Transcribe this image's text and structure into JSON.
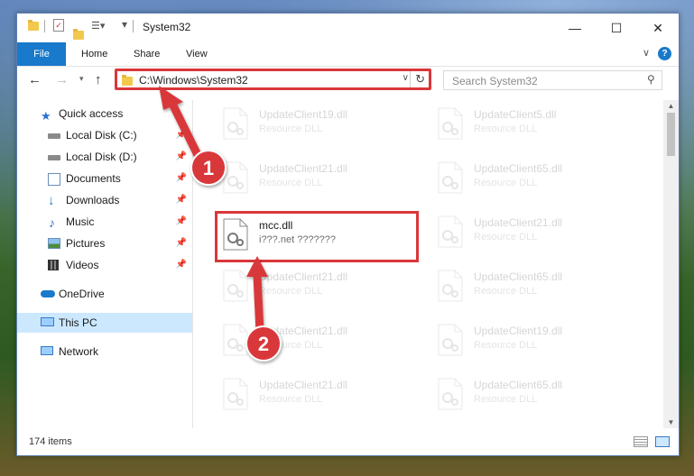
{
  "window": {
    "title": "System32",
    "controls": {
      "minimize": "—",
      "maximize": "☐",
      "close": "✕"
    }
  },
  "ribbon": {
    "tabs": [
      "File",
      "Home",
      "Share",
      "View"
    ],
    "help": "?"
  },
  "nav": {
    "address": "C:\\Windows\\System32",
    "search_placeholder": "Search System32"
  },
  "sidebar": {
    "items": [
      {
        "label": "Quick access",
        "icon": "star-icon",
        "pinned": false
      },
      {
        "label": "Local Disk (C:)",
        "icon": "drive-icon",
        "pinned": true
      },
      {
        "label": "Local Disk (D:)",
        "icon": "drive-icon",
        "pinned": true
      },
      {
        "label": "Documents",
        "icon": "documents-icon",
        "pinned": true
      },
      {
        "label": "Downloads",
        "icon": "download-icon",
        "pinned": true
      },
      {
        "label": "Music",
        "icon": "music-icon",
        "pinned": true
      },
      {
        "label": "Pictures",
        "icon": "pictures-icon",
        "pinned": true
      },
      {
        "label": "Videos",
        "icon": "videos-icon",
        "pinned": true
      },
      {
        "label": "OneDrive",
        "icon": "cloud-icon",
        "pinned": false
      },
      {
        "label": "This PC",
        "icon": "pc-icon",
        "pinned": false,
        "selected": true
      },
      {
        "label": "Network",
        "icon": "network-icon",
        "pinned": false
      }
    ]
  },
  "files": [
    {
      "name": "UpdateClient19.dll",
      "desc": "Resource DLL"
    },
    {
      "name": "UpdateClient5.dll",
      "desc": "Resource DLL"
    },
    {
      "name": "UpdateClient21.dll",
      "desc": "Resource DLL"
    },
    {
      "name": "UpdateClient65.dll",
      "desc": "Resource DLL"
    },
    {
      "name": "mcc.dll",
      "desc": "i???.net ???????"
    },
    {
      "name": "UpdateClient21.dll",
      "desc": "Resource DLL"
    },
    {
      "name": "UpdateClient21.dll",
      "desc": "Resource DLL"
    },
    {
      "name": "UpdateClient65.dll",
      "desc": "Resource DLL"
    },
    {
      "name": "UpdateClient21.dll",
      "desc": "Resource DLL"
    },
    {
      "name": "UpdateClient19.dll",
      "desc": "Resource DLL"
    },
    {
      "name": "UpdateClient21.dll",
      "desc": "Resource DLL"
    },
    {
      "name": "UpdateClient65.dll",
      "desc": "Resource DLL"
    }
  ],
  "status": {
    "items_count": "174 items"
  },
  "annotations": {
    "step1": "1",
    "step2": "2",
    "arrow_color": "#d9373a"
  }
}
